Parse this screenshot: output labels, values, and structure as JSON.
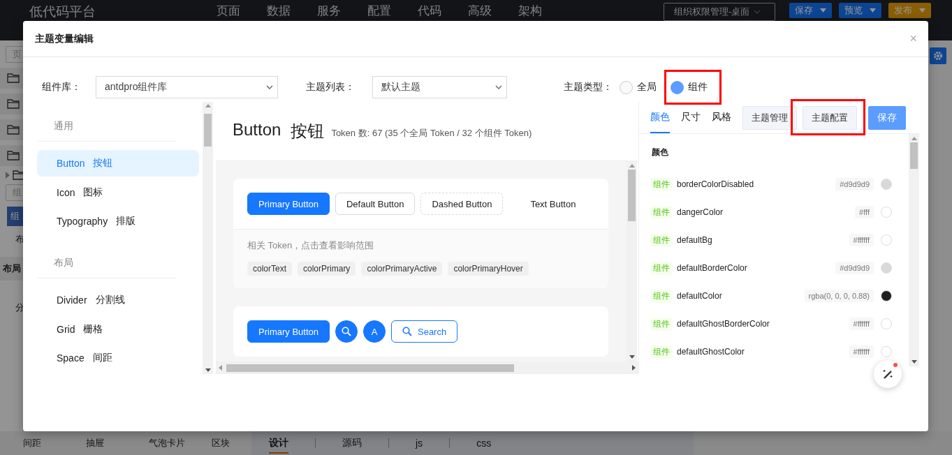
{
  "app": {
    "logo": "低代码平台",
    "nav": [
      "页面",
      "数据",
      "服务",
      "配置",
      "代码",
      "高级",
      "架构"
    ],
    "page_select": "组织权限管理-桌面",
    "actions": [
      {
        "label": "保存",
        "kind": "primary"
      },
      {
        "label": "预览",
        "kind": "primary"
      },
      {
        "label": "发布",
        "kind": "warning"
      }
    ],
    "left_panel": {
      "search_placeholder": "页",
      "field_placeholder": "组",
      "tab_button": "组",
      "row_text": "布",
      "section_title": "布局",
      "item_text": "分"
    },
    "bottom_components": [
      "间距",
      "抽屉",
      "气泡卡片",
      "区块"
    ],
    "editor_tabs": [
      {
        "label": "设计",
        "selected": true
      },
      {
        "label": "源码",
        "selected": false
      },
      {
        "label": "js",
        "selected": false
      },
      {
        "label": "css",
        "selected": false
      }
    ]
  },
  "dialog": {
    "title": "主题变量编辑",
    "close_label": "×",
    "filters": [
      {
        "label": "组件库：",
        "value": "antdpro组件库"
      },
      {
        "label": "主题列表：",
        "value": "默认主题"
      }
    ],
    "theme_type": {
      "label": "主题类型：",
      "options": [
        {
          "label": "全局",
          "selected": false,
          "highlighted": false
        },
        {
          "label": "组件",
          "selected": true,
          "highlighted": true
        }
      ]
    },
    "sidebar": {
      "groups": [
        {
          "title": "通用",
          "items": [
            {
              "name": "Button",
              "name_zh": "按钮",
              "selected": true
            },
            {
              "name": "Icon",
              "name_zh": "图标",
              "selected": false
            },
            {
              "name": "Typography",
              "name_zh": "排版",
              "selected": false
            }
          ]
        },
        {
          "title": "布局",
          "items": [
            {
              "name": "Divider",
              "name_zh": "分割线",
              "selected": false
            },
            {
              "name": "Grid",
              "name_zh": "栅格",
              "selected": false
            },
            {
              "name": "Space",
              "name_zh": "间距",
              "selected": false
            }
          ]
        }
      ]
    },
    "preview": {
      "title": "Button",
      "title_zh": "按钮",
      "token_count": "Token 数: 67 (35 个全局 Token / 32 个组件 Token)",
      "cards": [
        {
          "buttons": [
            {
              "label": "Primary Button",
              "kind": "primary"
            },
            {
              "label": "Default Button",
              "kind": "default"
            },
            {
              "label": "Dashed Button",
              "kind": "dashed"
            },
            {
              "label": "Text Button",
              "kind": "text"
            }
          ],
          "hint": "相关 Token，点击查看影响范围",
          "tokens": [
            "colorText",
            "colorPrimary",
            "colorPrimaryActive",
            "colorPrimaryHover"
          ]
        },
        {
          "buttons": [
            {
              "label": "Primary Button",
              "kind": "primary"
            },
            {
              "kind": "search-circle"
            },
            {
              "label": "A",
              "kind": "circle"
            },
            {
              "label": "Search",
              "kind": "search"
            }
          ]
        }
      ]
    },
    "token_panel": {
      "tabs": [
        {
          "label": "颜色",
          "selected": true
        },
        {
          "label": "尺寸",
          "selected": false
        },
        {
          "label": "风格",
          "selected": false
        }
      ],
      "actions": [
        {
          "label": "主题管理",
          "kind": "default",
          "highlighted": false
        },
        {
          "label": "主题配置",
          "kind": "default",
          "highlighted": true
        },
        {
          "label": "保存",
          "kind": "primary",
          "highlighted": false
        }
      ],
      "section": "颜色",
      "rows": [
        {
          "tag": "组件",
          "name": "borderColorDisabled",
          "value": "#d9d9d9",
          "color": "#d9d9d9"
        },
        {
          "tag": "组件",
          "name": "dangerColor",
          "value": "#fff",
          "color": "#ffffff"
        },
        {
          "tag": "组件",
          "name": "defaultBg",
          "value": "#ffffff",
          "color": "#ffffff"
        },
        {
          "tag": "组件",
          "name": "defaultBorderColor",
          "value": "#d9d9d9",
          "color": "#d9d9d9"
        },
        {
          "tag": "组件",
          "name": "defaultColor",
          "value": "rgba(0, 0, 0, 0.88)",
          "color": "#1f1f1f"
        },
        {
          "tag": "组件",
          "name": "defaultGhostBorderColor",
          "value": "#ffffff",
          "color": "#ffffff"
        },
        {
          "tag": "组件",
          "name": "defaultGhostColor",
          "value": "#ffffff",
          "color": "#ffffff"
        }
      ]
    }
  }
}
